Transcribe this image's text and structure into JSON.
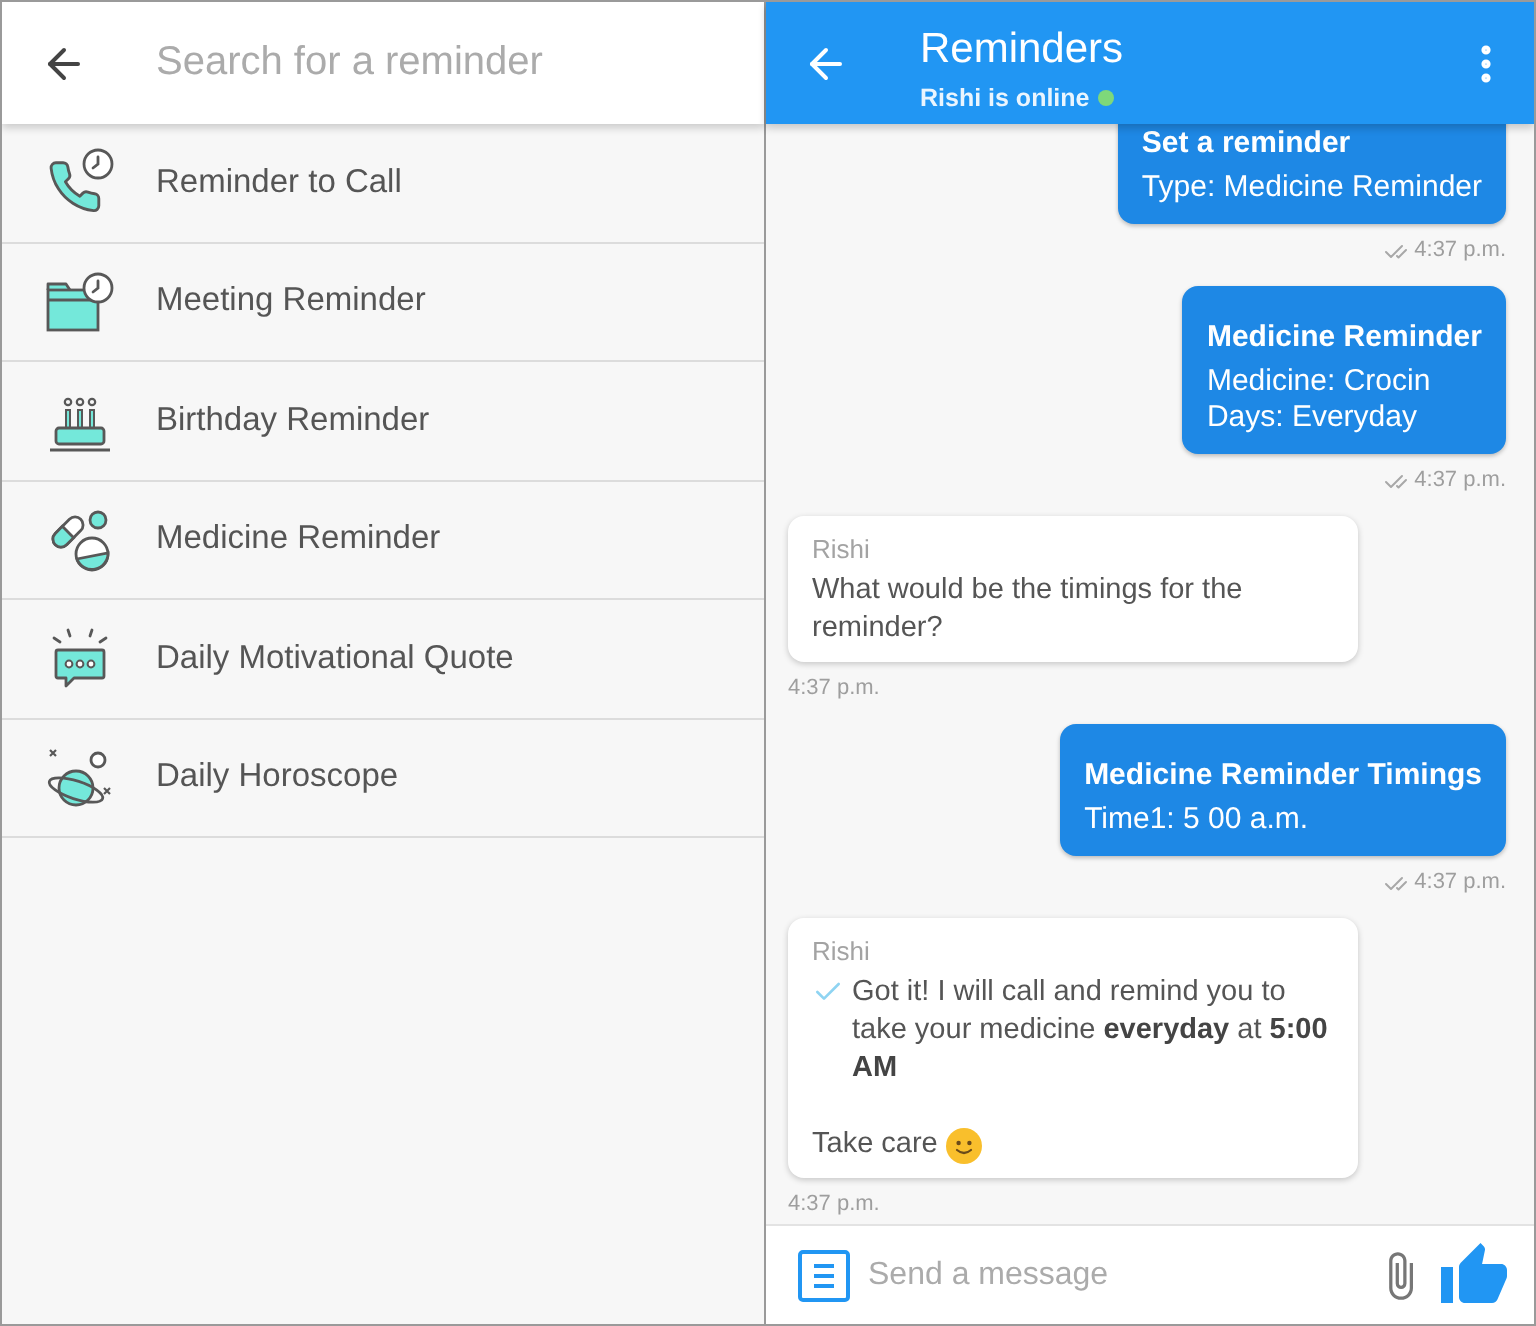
{
  "search_screen": {
    "search": {
      "placeholder": "Search for a reminder"
    },
    "items": [
      {
        "kind": "call",
        "label": "Reminder to Call"
      },
      {
        "kind": "meeting",
        "label": "Meeting Reminder"
      },
      {
        "kind": "birthday",
        "label": "Birthday Reminder"
      },
      {
        "kind": "medicine",
        "label": "Medicine Reminder"
      },
      {
        "kind": "quote",
        "label": "Daily Motivational Quote"
      },
      {
        "kind": "horoscope",
        "label": "Daily Horoscope"
      }
    ]
  },
  "chat": {
    "title": "Reminders",
    "status": "Rishi is online",
    "online": true,
    "messages": [
      {
        "kind": "sent",
        "title": "Set a reminder",
        "lines": [
          "Type: Medicine Reminder"
        ],
        "time": "4:37 p.m."
      },
      {
        "kind": "sent",
        "title": "Medicine Reminder",
        "lines": [
          "Medicine: Crocin",
          "Days: Everyday"
        ],
        "time": "4:37 p.m."
      },
      {
        "kind": "received",
        "sender": "Rishi",
        "paragraphs": [
          {
            "kind": "plain",
            "text": "What would be the timings for the reminder?"
          }
        ],
        "time": "4:37 p.m."
      },
      {
        "kind": "sent",
        "title": "Medicine Reminder Timings",
        "lines": [
          "Time1: 5 00 a.m."
        ],
        "time": "4:37 p.m."
      },
      {
        "kind": "received",
        "sender": "Rishi",
        "paragraphs": [
          {
            "kind": "confirmation",
            "text": "Got it! I will call and remind you to take your medicine **everyday** at **5:00 AM**"
          },
          {
            "kind": "closing",
            "text": "Take care"
          }
        ],
        "time": "4:37 p.m."
      }
    ],
    "composer": {
      "placeholder": "Send a message"
    }
  }
}
